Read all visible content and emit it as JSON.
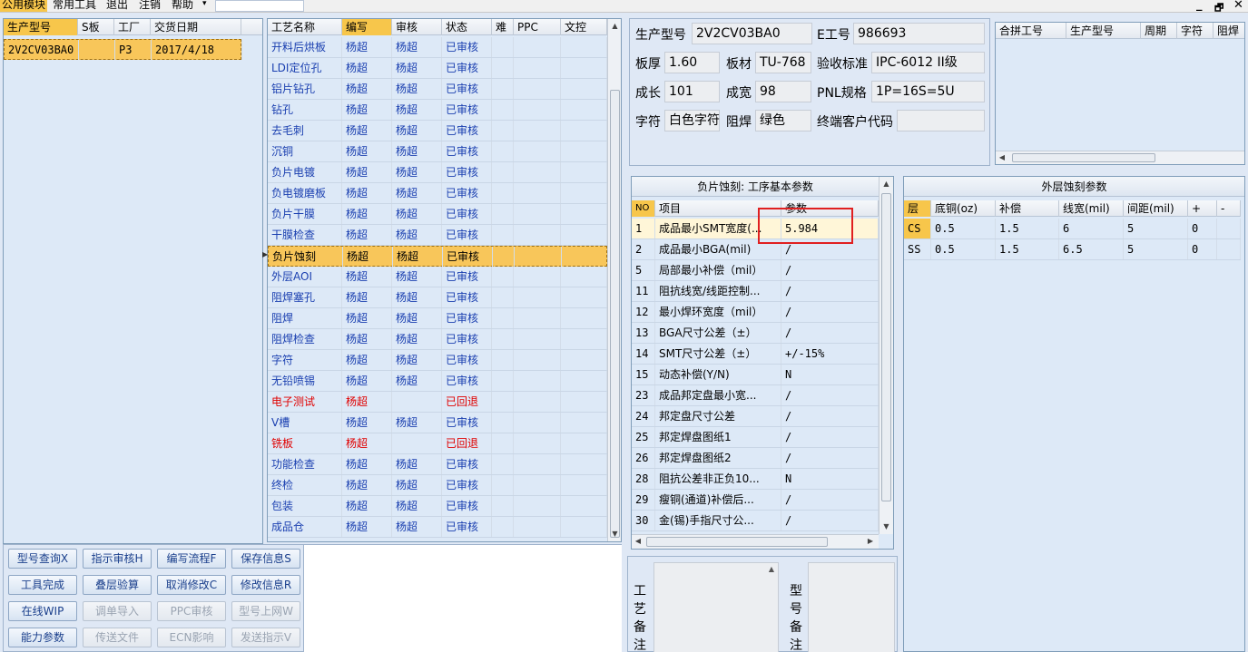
{
  "menu": {
    "items": [
      "公用模块",
      "常用工具",
      "退出",
      "注销",
      "帮助"
    ],
    "window_controls": [
      "_",
      "🗗",
      "✕"
    ]
  },
  "orders": {
    "headers": [
      "生产型号",
      "S板",
      "工厂",
      "交货日期"
    ],
    "rows": [
      {
        "model": "2V2CV03BA0",
        "s": "",
        "factory": "P3",
        "date": "2017/4/18"
      }
    ]
  },
  "process": {
    "headers": [
      "工艺名称",
      "编写",
      "审核",
      "状态",
      "难",
      "PPC",
      "文控"
    ],
    "rows": [
      {
        "name": "开料后烘板",
        "writer": "杨超",
        "reviewer": "杨超",
        "status": "已审核"
      },
      {
        "name": "LDI定位孔",
        "writer": "杨超",
        "reviewer": "杨超",
        "status": "已审核"
      },
      {
        "name": "铝片钻孔",
        "writer": "杨超",
        "reviewer": "杨超",
        "status": "已审核"
      },
      {
        "name": "钻孔",
        "writer": "杨超",
        "reviewer": "杨超",
        "status": "已审核"
      },
      {
        "name": "去毛刺",
        "writer": "杨超",
        "reviewer": "杨超",
        "status": "已审核"
      },
      {
        "name": "沉铜",
        "writer": "杨超",
        "reviewer": "杨超",
        "status": "已审核"
      },
      {
        "name": "负片电镀",
        "writer": "杨超",
        "reviewer": "杨超",
        "status": "已审核"
      },
      {
        "name": "负电镀磨板",
        "writer": "杨超",
        "reviewer": "杨超",
        "status": "已审核"
      },
      {
        "name": "负片干膜",
        "writer": "杨超",
        "reviewer": "杨超",
        "status": "已审核"
      },
      {
        "name": "干膜检查",
        "writer": "杨超",
        "reviewer": "杨超",
        "status": "已审核"
      },
      {
        "name": "负片蚀刻",
        "writer": "杨超",
        "reviewer": "杨超",
        "status": "已审核"
      },
      {
        "name": "外层AOI",
        "writer": "杨超",
        "reviewer": "杨超",
        "status": "已审核"
      },
      {
        "name": "阻焊塞孔",
        "writer": "杨超",
        "reviewer": "杨超",
        "status": "已审核"
      },
      {
        "name": "阻焊",
        "writer": "杨超",
        "reviewer": "杨超",
        "status": "已审核"
      },
      {
        "name": "阻焊检查",
        "writer": "杨超",
        "reviewer": "杨超",
        "status": "已审核"
      },
      {
        "name": "字符",
        "writer": "杨超",
        "reviewer": "杨超",
        "status": "已审核"
      },
      {
        "name": "无铅喷锡",
        "writer": "杨超",
        "reviewer": "杨超",
        "status": "已审核"
      },
      {
        "name": "电子测试",
        "writer": "杨超",
        "reviewer": "",
        "status": "已回退"
      },
      {
        "name": "V槽",
        "writer": "杨超",
        "reviewer": "杨超",
        "status": "已审核"
      },
      {
        "name": "铣板",
        "writer": "杨超",
        "reviewer": "",
        "status": "已回退"
      },
      {
        "name": "功能检查",
        "writer": "杨超",
        "reviewer": "杨超",
        "status": "已审核"
      },
      {
        "name": "终检",
        "writer": "杨超",
        "reviewer": "杨超",
        "status": "已审核"
      },
      {
        "name": "包装",
        "writer": "杨超",
        "reviewer": "杨超",
        "status": "已审核"
      },
      {
        "name": "成品仓",
        "writer": "杨超",
        "reviewer": "杨超",
        "status": "已审核"
      }
    ]
  },
  "info": {
    "model_label": "生产型号",
    "model": "2V2CV03BA0",
    "e_label": "E工号",
    "e": "986693",
    "thick_label": "板厚",
    "thick": "1.60",
    "mat_label": "板材",
    "mat": "TU-768",
    "std_label": "验收标准",
    "std": "IPC-6012 II级",
    "len_label": "成长",
    "len": "101",
    "wid_label": "成宽",
    "wid": "98",
    "pnl_label": "PNL规格",
    "pnl": "1P=16S=5U",
    "char_label": "字符",
    "char": "白色字符",
    "mask_label": "阻焊",
    "mask": "绿色",
    "cust_label": "终端客户代码",
    "cust": ""
  },
  "combine": {
    "headers": [
      "合拼工号",
      "生产型号",
      "周期",
      "字符",
      "阻焊"
    ]
  },
  "params": {
    "title": "负片蚀刻: 工序基本参数",
    "headers": [
      "NO",
      "项目",
      "参数"
    ],
    "rows": [
      {
        "no": "1",
        "item": "成品最小SMT宽度(...",
        "value": "5.984"
      },
      {
        "no": "2",
        "item": "成品最小BGA(mil)",
        "value": "/"
      },
      {
        "no": "5",
        "item": "局部最小补偿（mil）",
        "value": "/"
      },
      {
        "no": "11",
        "item": "阻抗线宽/线距控制...",
        "value": "/"
      },
      {
        "no": "12",
        "item": "最小焊环宽度（mil）",
        "value": "/"
      },
      {
        "no": "13",
        "item": "BGA尺寸公差（±）",
        "value": "/"
      },
      {
        "no": "14",
        "item": "SMT尺寸公差（±）",
        "value": "+/-15%"
      },
      {
        "no": "15",
        "item": "动态补偿(Y/N)",
        "value": "N"
      },
      {
        "no": "23",
        "item": "成品邦定盘最小宽...",
        "value": "/"
      },
      {
        "no": "24",
        "item": "邦定盘尺寸公差",
        "value": "/"
      },
      {
        "no": "25",
        "item": "邦定焊盘图纸1",
        "value": "/"
      },
      {
        "no": "26",
        "item": "邦定焊盘图纸2",
        "value": "/"
      },
      {
        "no": "28",
        "item": "阻抗公差非正负10...",
        "value": "N"
      },
      {
        "no": "29",
        "item": "瘦铜(通道)补偿后...",
        "value": "/"
      },
      {
        "no": "30",
        "item": "金(锡)手指尺寸公...",
        "value": "/"
      }
    ]
  },
  "outer": {
    "title": "外层蚀刻参数",
    "headers": [
      "层",
      "底铜(oz)",
      "补偿",
      "线宽(mil)",
      "间距(mil)",
      "+",
      "-"
    ],
    "rows": [
      {
        "layer": "CS",
        "base": "0.5",
        "comp": "1.5",
        "width": "6",
        "gap": "5",
        "plus": "0",
        "minus": ""
      },
      {
        "layer": "SS",
        "base": "0.5",
        "comp": "1.5",
        "width": "6.5",
        "gap": "5",
        "plus": "0",
        "minus": ""
      }
    ]
  },
  "buttons": [
    {
      "label": "型号查询X",
      "enabled": true
    },
    {
      "label": "指示审核H",
      "enabled": true
    },
    {
      "label": "编写流程F",
      "enabled": true
    },
    {
      "label": "保存信息S",
      "enabled": true
    },
    {
      "label": "工具完成",
      "enabled": true
    },
    {
      "label": "叠层验算",
      "enabled": true
    },
    {
      "label": "取消修改C",
      "enabled": true
    },
    {
      "label": "修改信息R",
      "enabled": true
    },
    {
      "label": "在线WIP",
      "enabled": true
    },
    {
      "label": "调单导入",
      "enabled": false
    },
    {
      "label": "PPC审核",
      "enabled": false
    },
    {
      "label": "型号上网W",
      "enabled": false
    },
    {
      "label": "能力参数",
      "enabled": true
    },
    {
      "label": "传送文件",
      "enabled": false
    },
    {
      "label": "ECN影响",
      "enabled": false
    },
    {
      "label": "发送指示V",
      "enabled": false
    }
  ],
  "notes": {
    "process_label": "工艺备注",
    "model_label": "型号备注"
  }
}
